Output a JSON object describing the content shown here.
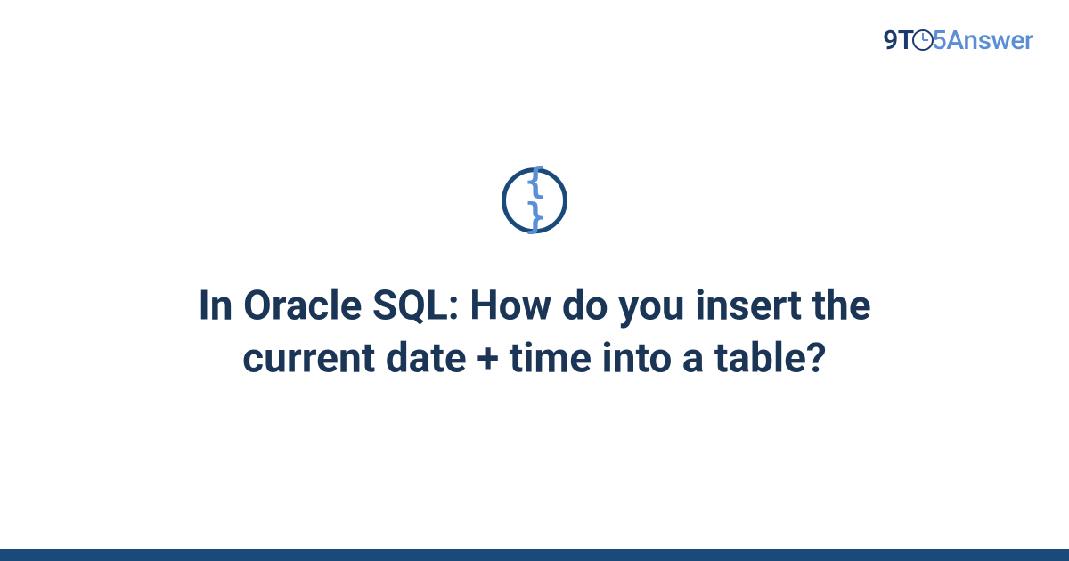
{
  "brand": {
    "left": "9T",
    "right": "5Answer"
  },
  "badge": {
    "glyph": "{ }",
    "name": "code-braces-icon"
  },
  "question": {
    "title": "In Oracle SQL: How do you insert the current date + time into a table?"
  },
  "colors": {
    "brand_dark": "#1a3a6e",
    "brand_light": "#5a8fd6",
    "title_text": "#1a3555",
    "bottom_bar": "#1a4a7a"
  }
}
